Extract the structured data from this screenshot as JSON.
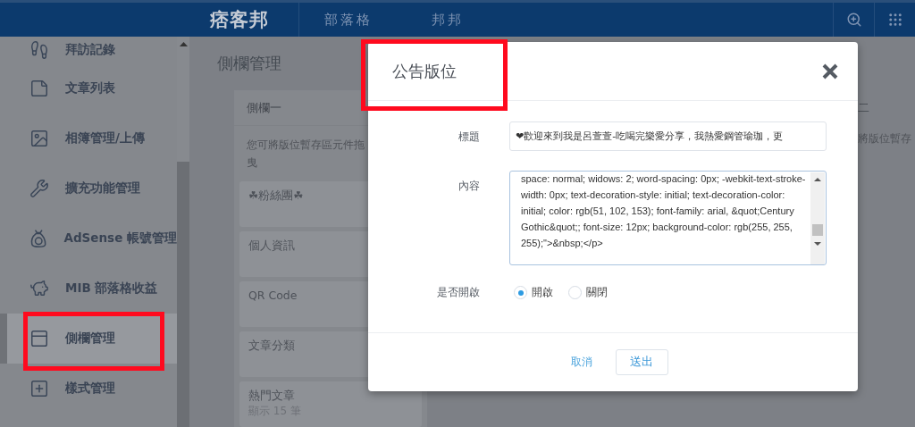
{
  "nav": {
    "logo": "痞客邦",
    "links": [
      {
        "label": "部落格"
      },
      {
        "label": "邦邦"
      }
    ]
  },
  "sidebar": {
    "items": [
      {
        "label": "拜訪記錄",
        "kind": "foot",
        "selected": false
      },
      {
        "label": "文章列表",
        "kind": "doc",
        "selected": false
      },
      {
        "label": "相簿管理/上傳",
        "kind": "image",
        "selected": false
      },
      {
        "label": "擴充功能管理",
        "kind": "wrench",
        "selected": false
      },
      {
        "label": "AdSense 帳號管理",
        "kind": "bag",
        "selected": false
      },
      {
        "label": "MIB 部落格收益",
        "kind": "piggy",
        "selected": false
      },
      {
        "label": "側欄管理",
        "kind": "panel",
        "selected": true
      },
      {
        "label": "樣式管理",
        "kind": "plus",
        "selected": false
      }
    ]
  },
  "page_title": "側欄管理",
  "columns": [
    {
      "title": "側欄一",
      "hint": "您可將版位暫存區元件拖曳",
      "widgets": [
        {
          "name": "☘粉絲團☘"
        },
        {
          "name": "個人資訊"
        },
        {
          "name": "QR Code"
        },
        {
          "name": "文章分類"
        },
        {
          "name": "熱門文章",
          "note": "顯示 15 筆"
        }
      ]
    },
    {
      "title": "二",
      "hint": "將版位暫存"
    }
  ],
  "dialog": {
    "title": "公告版位",
    "fields": [
      {
        "label": "標題",
        "kind": "input",
        "value": "❤歡迎來到我是呂萱萱-吃喝完樂愛分享，我熱愛鋼管瑜珈，更"
      },
      {
        "label": "內容",
        "kind": "textarea",
        "value": "space: normal; widows: 2; word-spacing: 0px; -webkit-text-stroke-width: 0px; text-decoration-style: initial; text-decoration-color: initial; color: rgb(51, 102, 153); font-family: arial, &quot;Century Gothic&quot;; font-size: 12px; background-color: rgb(255, 255, 255);\">&nbsp;</p>"
      },
      {
        "label": "是否開啟",
        "kind": "radio",
        "options": [
          {
            "label": "開啟",
            "selected": true
          },
          {
            "label": "關閉",
            "selected": false
          }
        ]
      }
    ],
    "buttons": [
      {
        "label": "取消",
        "kind": "link"
      },
      {
        "label": "送出",
        "kind": "outline"
      }
    ]
  }
}
